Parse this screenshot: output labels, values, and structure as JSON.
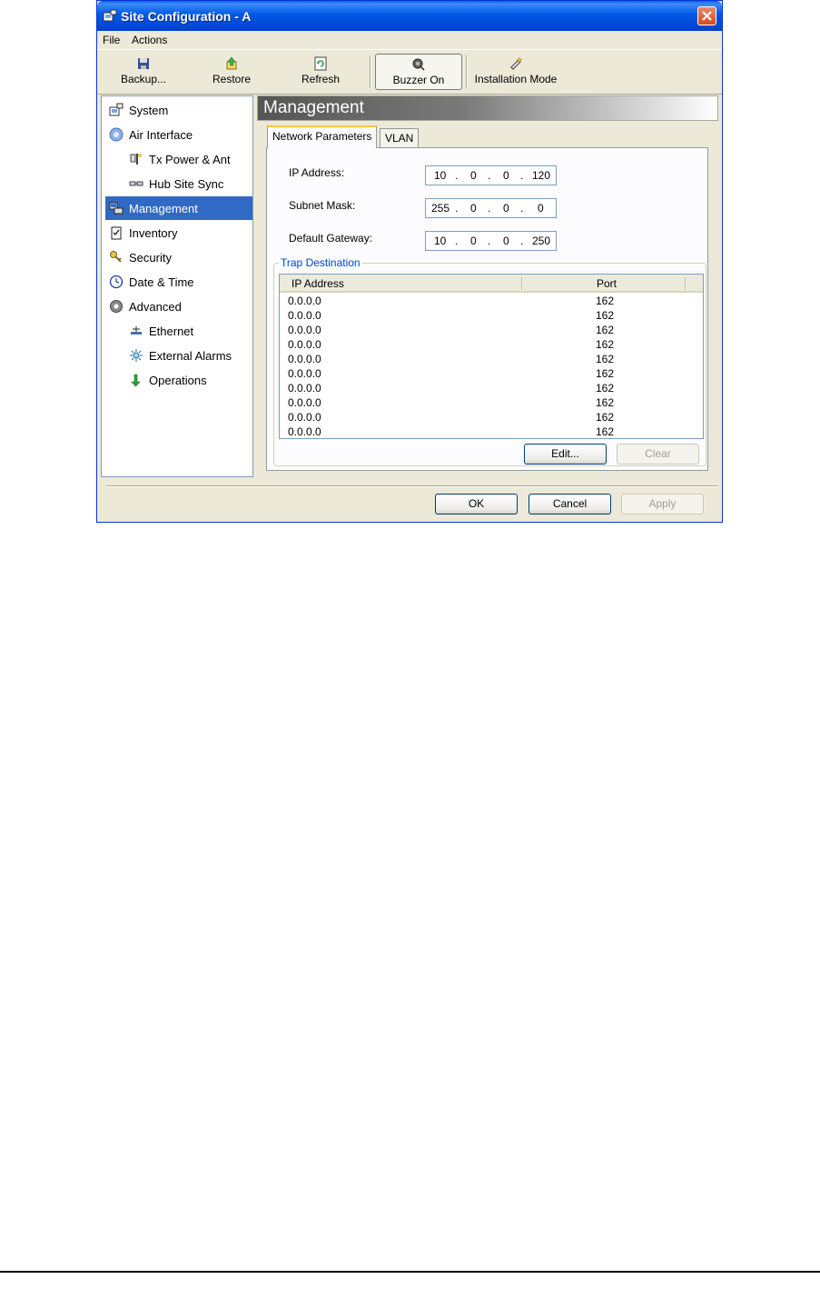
{
  "window": {
    "title": "Site Configuration - A",
    "menu": [
      "File",
      "Actions"
    ],
    "toolbar": {
      "backup": "Backup...",
      "restore": "Restore",
      "refresh": "Refresh",
      "buzzer": "Buzzer On",
      "installation": "Installation Mode"
    }
  },
  "tree": {
    "items": [
      {
        "label": "System",
        "icon": "system-icon"
      },
      {
        "label": "Air Interface",
        "icon": "air-interface-icon"
      },
      {
        "label": "Tx Power & Ant",
        "icon": "antenna-icon"
      },
      {
        "label": "Hub Site Sync",
        "icon": "sync-icon"
      },
      {
        "label": "Management",
        "icon": "management-icon"
      },
      {
        "label": "Inventory",
        "icon": "inventory-icon"
      },
      {
        "label": "Security",
        "icon": "keys-icon"
      },
      {
        "label": "Date & Time",
        "icon": "clock-icon"
      },
      {
        "label": "Advanced",
        "icon": "gear-icon"
      },
      {
        "label": "Ethernet",
        "icon": "ethernet-icon"
      },
      {
        "label": "External Alarms",
        "icon": "alarm-icon"
      },
      {
        "label": "Operations",
        "icon": "operations-arrow-icon"
      }
    ],
    "selected": "Management"
  },
  "content": {
    "header": "Management",
    "tabs": [
      "Network Parameters",
      "VLAN"
    ],
    "active_tab": "Network Parameters",
    "ip_address": {
      "label": "IP Address:",
      "octets": [
        "10",
        "0",
        "0",
        "120"
      ]
    },
    "subnet_mask": {
      "label": "Subnet Mask:",
      "octets": [
        "255",
        "0",
        "0",
        "0"
      ]
    },
    "default_gateway": {
      "label": "Default Gateway:",
      "octets": [
        "10",
        "0",
        "0",
        "250"
      ]
    },
    "trap": {
      "title": "Trap Destination",
      "columns": [
        "IP Address",
        "Port"
      ],
      "rows": [
        {
          "ip": "0.0.0.0",
          "port": "162"
        },
        {
          "ip": "0.0.0.0",
          "port": "162"
        },
        {
          "ip": "0.0.0.0",
          "port": "162"
        },
        {
          "ip": "0.0.0.0",
          "port": "162"
        },
        {
          "ip": "0.0.0.0",
          "port": "162"
        },
        {
          "ip": "0.0.0.0",
          "port": "162"
        },
        {
          "ip": "0.0.0.0",
          "port": "162"
        },
        {
          "ip": "0.0.0.0",
          "port": "162"
        },
        {
          "ip": "0.0.0.0",
          "port": "162"
        },
        {
          "ip": "0.0.0.0",
          "port": "162"
        }
      ],
      "edit_label": "Edit...",
      "clear_label": "Clear"
    }
  },
  "buttons": {
    "ok": "OK",
    "cancel": "Cancel",
    "apply": "Apply"
  }
}
